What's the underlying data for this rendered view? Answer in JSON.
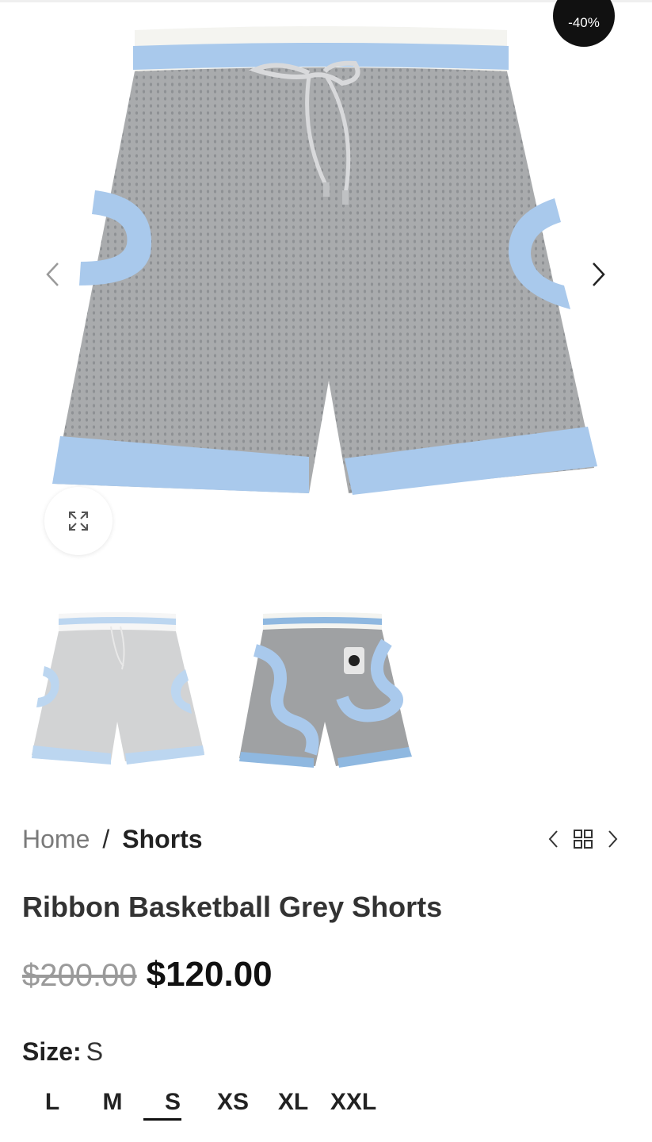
{
  "gallery": {
    "badge": "-40%",
    "prev_icon": "chevron-left-icon",
    "next_icon": "chevron-right-icon",
    "zoom_icon": "expand-icon",
    "shorts_colors": {
      "mesh": "#a7a9ab",
      "trim": "#a9c9ec",
      "waistband": "#f3f3ef"
    }
  },
  "breadcrumb": {
    "home": "Home",
    "separator": "/",
    "current": "Shorts"
  },
  "product_nav": {
    "prev_icon": "chevron-left-icon",
    "grid_icon": "grid-icon",
    "next_icon": "chevron-right-icon"
  },
  "product": {
    "title": "Ribbon Basketball Grey Shorts",
    "old_price": "$200.00",
    "new_price": "$120.00",
    "size_label": "Size",
    "size_colon": ":",
    "selected_size": "S",
    "sizes": [
      "L",
      "M",
      "S",
      "XS",
      "XL",
      "XXL"
    ]
  }
}
